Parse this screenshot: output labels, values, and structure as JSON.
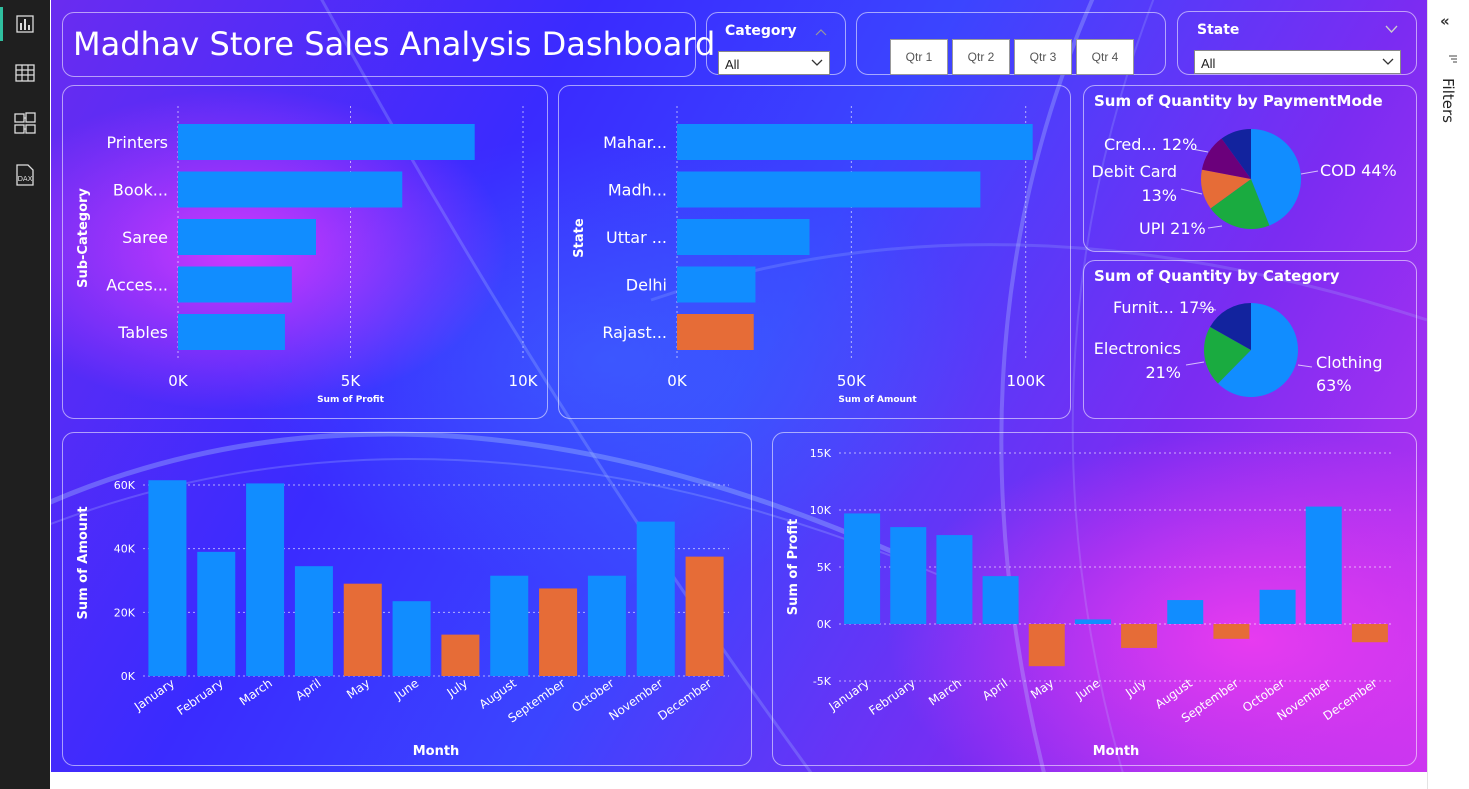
{
  "dashboard": {
    "title": "Madhav Store Sales Analysis Dashboard"
  },
  "slicers": {
    "category": {
      "label": "Category",
      "value": "All"
    },
    "state": {
      "label": "State",
      "value": "All"
    },
    "quarters": [
      "Qtr 1",
      "Qtr 2",
      "Qtr 3",
      "Qtr 4"
    ]
  },
  "filters_pane": {
    "label": "Filters"
  },
  "rail_icons": [
    "report-view-icon",
    "table-view-icon",
    "model-view-icon",
    "dax-query-icon"
  ],
  "rail": {
    "dax_label": "DAX"
  },
  "colors": {
    "positive": "#118dff",
    "negative": "#e66c37",
    "upi": "#1aab40",
    "other": "#6b007b",
    "rest": "#12239e"
  },
  "chart_data": [
    {
      "type": "bar",
      "orientation": "horizontal",
      "categories": [
        "Printers",
        "Book...",
        "Saree",
        "Acces...",
        "Tables"
      ],
      "values": [
        8600,
        6500,
        4000,
        3300,
        3100
      ],
      "highlight": [
        false,
        false,
        false,
        false,
        false
      ],
      "xlabel": "Sum of Profit",
      "ylabel": "Sub-Category",
      "xlim": [
        0,
        10000
      ],
      "ticks": [
        "0K",
        "5K",
        "10K"
      ]
    },
    {
      "type": "bar",
      "orientation": "horizontal",
      "categories": [
        "Mahar...",
        "Madh...",
        "Uttar ...",
        "Delhi",
        "Rajast..."
      ],
      "values": [
        102000,
        87000,
        38000,
        22500,
        22000
      ],
      "highlight": [
        false,
        false,
        false,
        false,
        true
      ],
      "xlabel": "Sum of Amount",
      "ylabel": "State",
      "xlim": [
        0,
        115000
      ],
      "ticks": [
        "0K",
        "50K",
        "100K"
      ]
    },
    {
      "type": "pie",
      "title": "Sum of Quantity by PaymentMode",
      "slices": [
        {
          "label": "COD 44%",
          "value": 44
        },
        {
          "label": "UPI 21%",
          "value": 21
        },
        {
          "label": "Debit Card 13%",
          "value": 13
        },
        {
          "label": "Cred... 12%",
          "value": 12
        },
        {
          "label": "",
          "value": 10
        }
      ]
    },
    {
      "type": "pie",
      "title": "Sum of Quantity by Category",
      "slices": [
        {
          "label": "Clothing 63%",
          "value": 63
        },
        {
          "label": "Electronics 21%",
          "value": 21
        },
        {
          "label": "Furnit... 17%",
          "value": 17
        }
      ]
    },
    {
      "type": "bar",
      "categories": [
        "January",
        "February",
        "March",
        "April",
        "May",
        "June",
        "July",
        "August",
        "September",
        "October",
        "November",
        "December"
      ],
      "values": [
        61500,
        39000,
        60500,
        34500,
        29000,
        23500,
        13000,
        31500,
        27500,
        31500,
        48500,
        37500
      ],
      "highlight": [
        false,
        false,
        false,
        false,
        true,
        false,
        true,
        false,
        true,
        false,
        false,
        true
      ],
      "xlabel": "Month",
      "ylabel": "Sum of Amount",
      "ylim": [
        0,
        60000
      ],
      "ticks": [
        "0K",
        "20K",
        "40K",
        "60K"
      ]
    },
    {
      "type": "bar",
      "categories": [
        "January",
        "February",
        "March",
        "April",
        "May",
        "June",
        "July",
        "August",
        "September",
        "October",
        "November",
        "December"
      ],
      "values": [
        9700,
        8500,
        7800,
        4200,
        -3700,
        400,
        -2100,
        2100,
        -1300,
        3000,
        10300,
        -1600
      ],
      "xlabel": "Month",
      "ylabel": "Sum of Profit",
      "ylim": [
        -5000,
        15000
      ],
      "ticks": [
        "-5K",
        "0K",
        "5K",
        "10K",
        "15K"
      ]
    }
  ]
}
